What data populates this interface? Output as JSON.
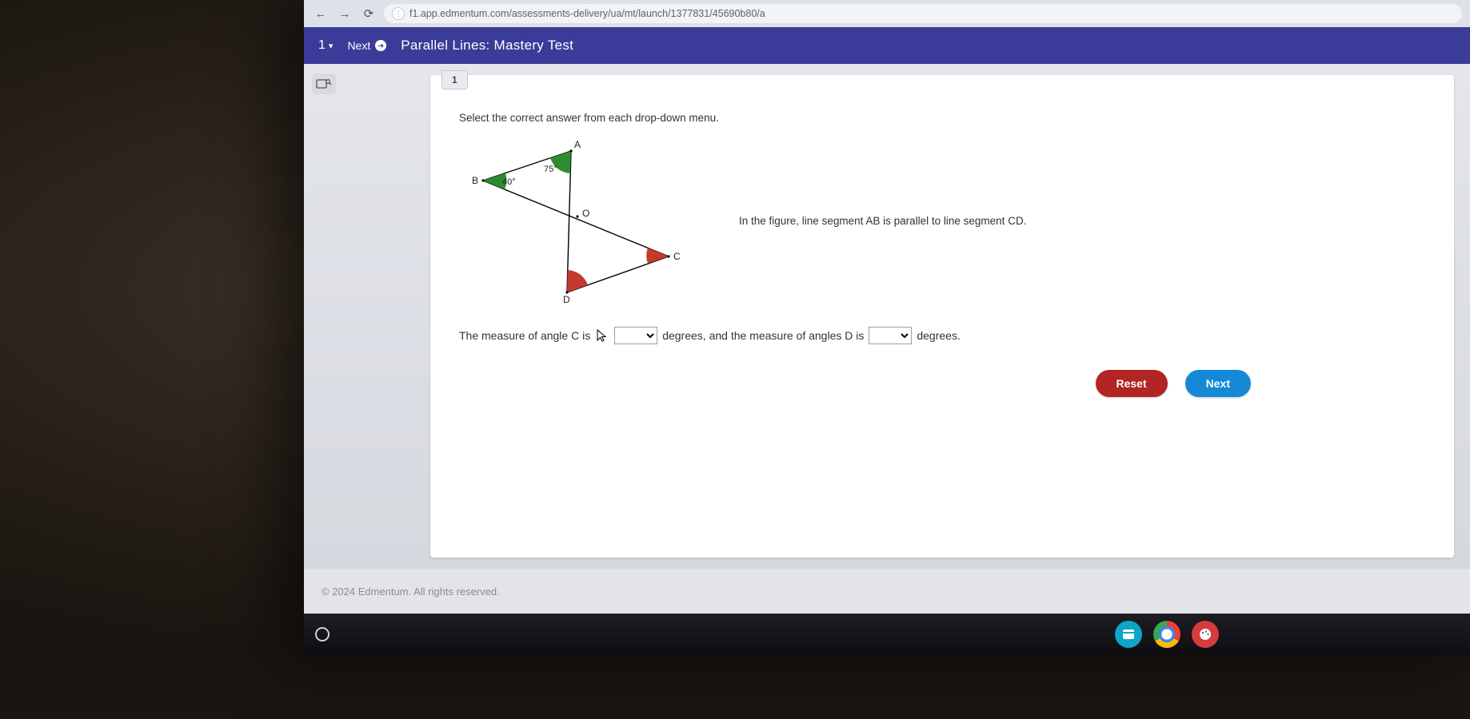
{
  "browser": {
    "url": "f1.app.edmentum.com/assessments-delivery/ua/mt/launch/1377831/45690b80/a"
  },
  "header": {
    "question_number": "1",
    "next_label": "Next",
    "title": "Parallel Lines: Mastery Test"
  },
  "question": {
    "tab_number": "1",
    "instruction": "Select the correct answer from each drop-down menu.",
    "figure": {
      "points": {
        "A": "A",
        "B": "B",
        "C": "C",
        "D": "D",
        "O": "O"
      },
      "angles": {
        "at_A": "75°",
        "at_B": "40°"
      }
    },
    "figure_statement": "In the figure, line segment AB is parallel to line segment CD.",
    "sentence": {
      "part1": "The measure of angle C is",
      "part2": "degrees, and the measure of angles D is",
      "part3": "degrees."
    },
    "dropdowns": {
      "angle_C": "",
      "angle_D": ""
    },
    "buttons": {
      "reset": "Reset",
      "next": "Next"
    }
  },
  "footer": {
    "copyright": "© 2024 Edmentum. All rights reserved."
  }
}
